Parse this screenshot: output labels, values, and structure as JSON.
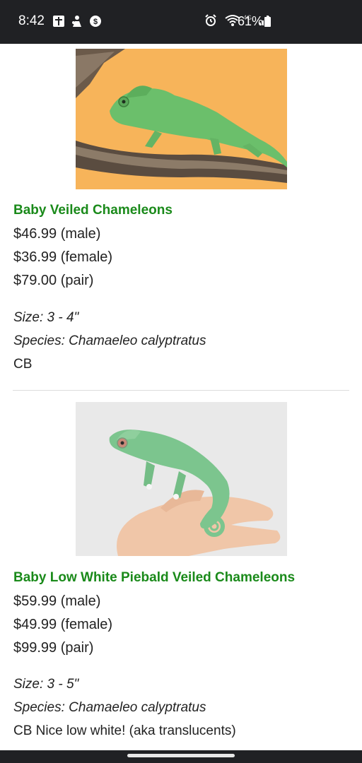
{
  "status_bar": {
    "time": "8:42",
    "network_label": "4G",
    "battery_percent": "61%",
    "icons": [
      "calendar-icon",
      "notification-icon",
      "s-app-icon",
      "alarm-icon",
      "wifi-icon",
      "signal-icon",
      "battery-icon"
    ]
  },
  "products": [
    {
      "title": "Baby Veiled Chameleons",
      "prices": [
        "$46.99 (male)",
        "$36.99 (female)",
        "$79.00 (pair)"
      ],
      "size": "Size: 3 - 4\"",
      "species": "Species: Chamaeleo calyptratus",
      "note": "CB",
      "image": {
        "background": "#f7b45a",
        "animal_color": "#6bbf6b"
      }
    },
    {
      "title": "Baby Low White Piebald Veiled Chameleons",
      "prices": [
        "$59.99 (male)",
        "$49.99 (female)",
        "$99.99 (pair)"
      ],
      "size": "Size: 3 - 5\"",
      "species": "Species: Chamaeleo calyptratus",
      "note": "CB Nice low white! (aka translucents)",
      "image": {
        "background": "#e9e9e9",
        "animal_color": "#7cc58e"
      }
    }
  ],
  "colors": {
    "title_green": "#1a8a1a",
    "text": "#222222",
    "status_bar_bg": "#202124"
  }
}
